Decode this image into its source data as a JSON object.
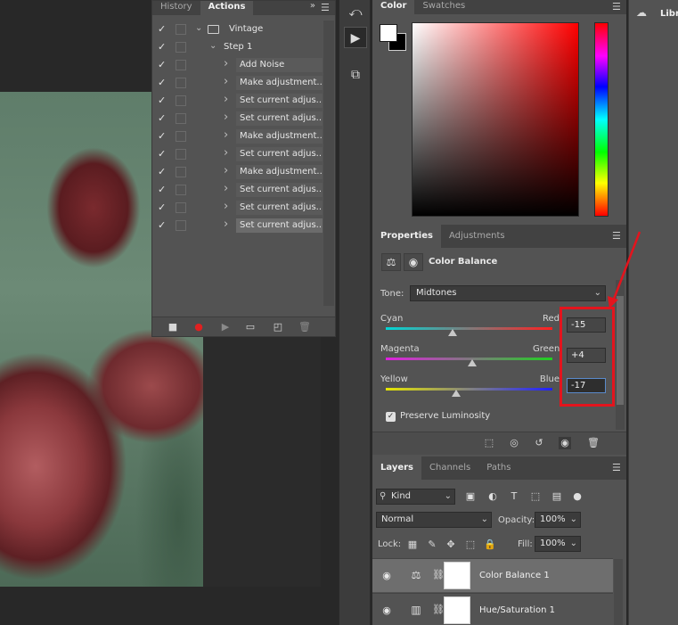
{
  "actions_panel": {
    "tabs": [
      {
        "label": "History"
      },
      {
        "label": "Actions"
      }
    ],
    "expand_glyph": "»",
    "rows": [
      {
        "label": "Vintage",
        "level": 0,
        "icon": "folder-icon"
      },
      {
        "label": "Step 1",
        "level": 1
      },
      {
        "label": "Add Noise",
        "level": 2
      },
      {
        "label": "Make adjustment...",
        "level": 2
      },
      {
        "label": "Set current adjus...",
        "level": 2
      },
      {
        "label": "Set current adjus...",
        "level": 2
      },
      {
        "label": "Make adjustment...",
        "level": 2
      },
      {
        "label": "Set current adjus...",
        "level": 2
      },
      {
        "label": "Make adjustment...",
        "level": 2
      },
      {
        "label": "Set current adjus...",
        "level": 2
      },
      {
        "label": "Set current adjus...",
        "level": 2
      },
      {
        "label": "Set current adjus...",
        "level": 2,
        "selected": true
      }
    ]
  },
  "color_panel": {
    "tabs": [
      {
        "label": "Color"
      },
      {
        "label": "Swatches"
      }
    ],
    "foreground": "#ffffff",
    "background": "#000000",
    "field_hue": "#ff0000"
  },
  "properties_panel": {
    "tabs": [
      {
        "label": "Properties"
      },
      {
        "label": "Adjustments"
      }
    ],
    "title": "Color Balance",
    "tone_label": "Tone:",
    "tone_value": "Midtones",
    "sliders": [
      {
        "left": "Cyan",
        "right": "Red",
        "value": "-15",
        "position": 0.4,
        "gradient_from": "#00d6d6",
        "gradient_to": "#ff2020"
      },
      {
        "left": "Magenta",
        "right": "Green",
        "value": "+4",
        "position": 0.52,
        "gradient_from": "#e020e0",
        "gradient_to": "#20d020"
      },
      {
        "left": "Yellow",
        "right": "Blue",
        "value": "-17",
        "position": 0.42,
        "gradient_from": "#e6e600",
        "gradient_to": "#2020ff"
      }
    ],
    "preserve_luminosity": "Preserve Luminosity"
  },
  "layers_panel": {
    "tabs": [
      {
        "label": "Layers"
      },
      {
        "label": "Channels"
      },
      {
        "label": "Paths"
      }
    ],
    "filter_kind": "Kind",
    "blend_mode": "Normal",
    "opacity_label": "Opacity:",
    "opacity_value": "100%",
    "lock_label": "Lock:",
    "fill_label": "Fill:",
    "fill_value": "100%",
    "layers": [
      {
        "name": "Color Balance 1",
        "icon": "balance-icon",
        "selected": true
      },
      {
        "name": "Hue/Saturation 1",
        "icon": "hue-saturation-icon",
        "selected": false
      }
    ]
  },
  "libraries": {
    "label": "Libra"
  },
  "annotation": {
    "color": "#e3141d"
  }
}
